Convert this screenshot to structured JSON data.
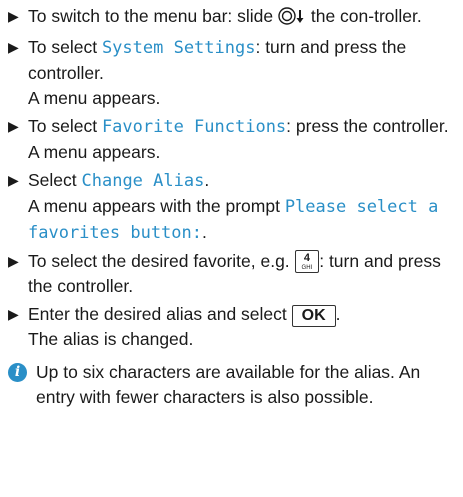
{
  "steps": [
    {
      "text_a": "To switch to the menu bar: slide ",
      "text_b": " the con-troller."
    },
    {
      "pre": "To select ",
      "code": "System Settings",
      "post": ": turn and press the controller.",
      "result": "A menu appears."
    },
    {
      "pre": "To select ",
      "code": "Favorite Functions",
      "post": ": press the controller.",
      "result": "A menu appears."
    },
    {
      "pre": "Select ",
      "code": "Change Alias",
      "post": ".",
      "result_pre": "A menu appears with the prompt ",
      "result_code": "Please select a favorites button:",
      "result_post": "."
    },
    {
      "pre": "To select the desired favorite, e.g. ",
      "key_main": "4",
      "key_sub": "GHI",
      "post": ": turn and press the controller."
    },
    {
      "pre": "Enter the desired alias and select ",
      "button": "OK",
      "post": ".",
      "result": "The alias is changed."
    }
  ],
  "note": "Up to six characters are available for the alias. An entry with fewer characters is also possible.",
  "icons": {
    "bullet": "triangle-right-icon",
    "controller": "controller-slide-down-icon",
    "info": "info-icon"
  },
  "colors": {
    "accent": "#2a8fc7"
  }
}
